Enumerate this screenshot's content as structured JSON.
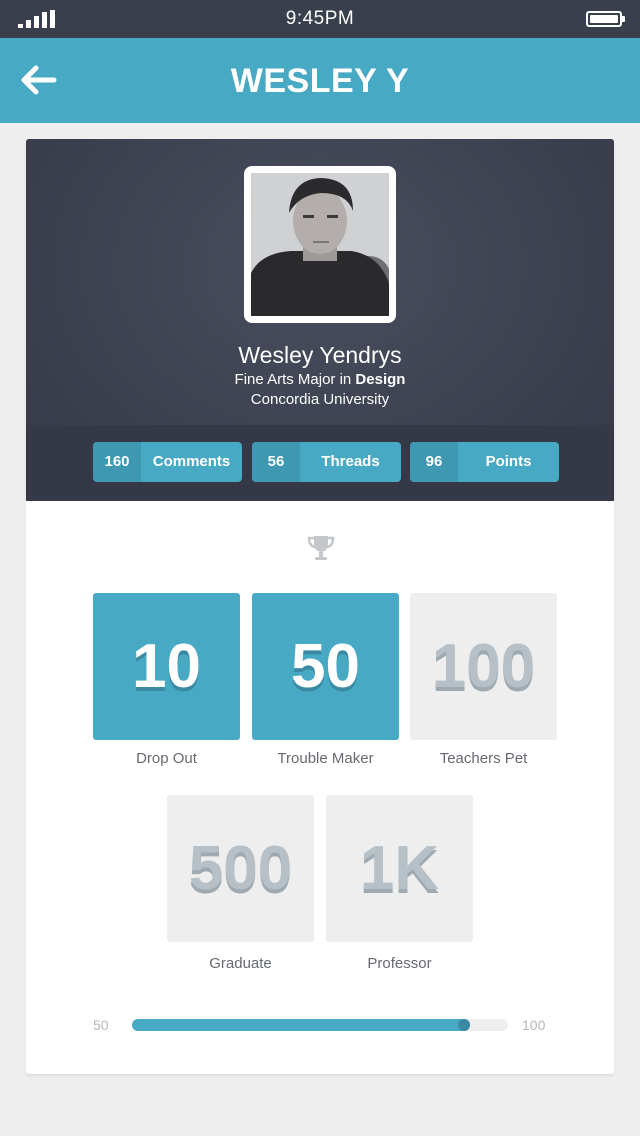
{
  "status_bar": {
    "time": "9:45PM",
    "signal_icon": "signal-bars-icon",
    "battery_icon": "battery-icon"
  },
  "nav": {
    "title": "WESLEY Y",
    "back_icon": "arrow-left-icon"
  },
  "profile": {
    "name": "Wesley Yendrys",
    "major_prefix": "Fine Arts Major in ",
    "major_subject": "Design",
    "school": "Concordia University",
    "avatar_icon": "profile-photo"
  },
  "stats": [
    {
      "count": "160",
      "label": "Comments"
    },
    {
      "count": "56",
      "label": "Threads"
    },
    {
      "count": "96",
      "label": "Points"
    }
  ],
  "badges_icon": "trophy-icon",
  "badges": [
    {
      "value": "10",
      "label": "Drop Out",
      "earned": true
    },
    {
      "value": "50",
      "label": "Trouble Maker",
      "earned": true
    },
    {
      "value": "100",
      "label": "Teachers Pet",
      "earned": false
    },
    {
      "value": "500",
      "label": "Graduate",
      "earned": false
    },
    {
      "value": "1K",
      "label": "Professor",
      "earned": false
    }
  ],
  "progress": {
    "min_label": "50",
    "max_label": "100",
    "fraction": 0.9
  },
  "colors": {
    "accent": "#48a9c5",
    "accent_dark": "#3f98b2",
    "header_bg": "#3a3f4d",
    "page_bg": "#eeeeee"
  }
}
